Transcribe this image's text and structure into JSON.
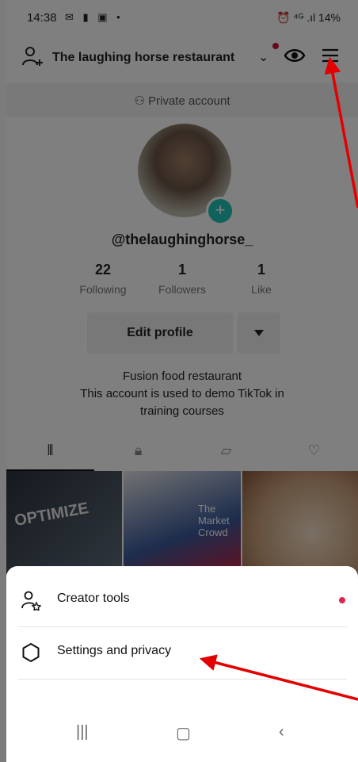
{
  "status_bar": {
    "time": "14:38",
    "left_icons": "✉ ▮ ▣ •",
    "right_text": "⏰ ⁴ᴳ .ıl 14%"
  },
  "header": {
    "account_name": "The laughing horse restaurant",
    "private_label": "Private account"
  },
  "profile": {
    "handle": "@thelaughinghorse_",
    "stats": [
      {
        "value": "22",
        "label": "Following"
      },
      {
        "value": "1",
        "label": "Followers"
      },
      {
        "value": "1",
        "label": "Like"
      }
    ],
    "edit_profile_label": "Edit profile",
    "bio": [
      "Fusion food restaurant",
      "This account is used to demo TikTok in",
      "training courses"
    ]
  },
  "thumbs": {
    "first_text": "OPTIMIZE",
    "second_text": "The Market Crowd"
  },
  "sheet": {
    "items": [
      {
        "label": "Creator tools",
        "icon": "person-star-icon",
        "has_dot": true
      },
      {
        "label": "Settings and privacy",
        "icon": "gear-icon",
        "has_dot": false
      }
    ]
  },
  "colors": {
    "accent_red": "#e0274a",
    "annotation_red": "#e30000",
    "teal": "#20c5ba"
  }
}
